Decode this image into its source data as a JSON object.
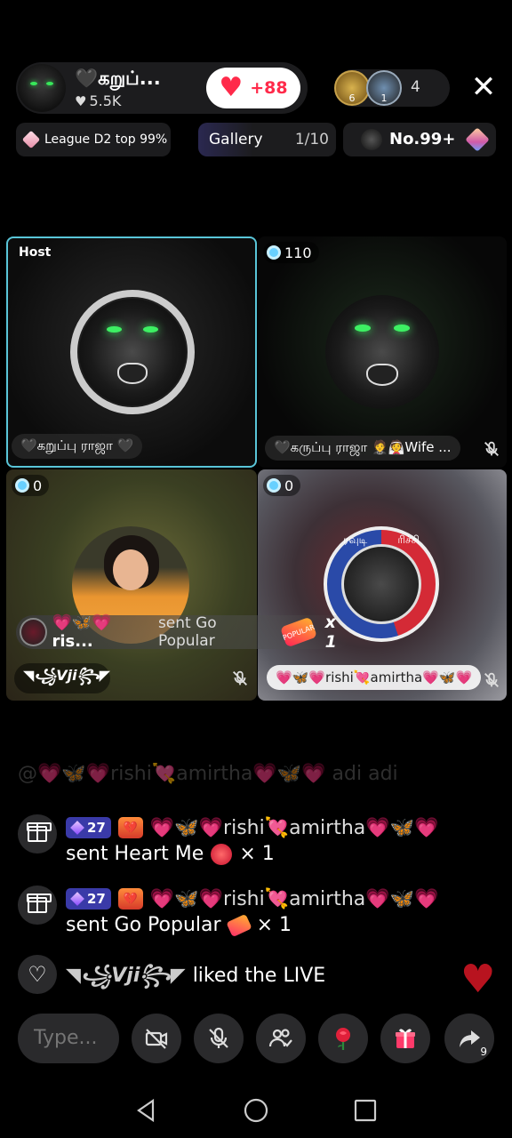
{
  "header": {
    "host_name": "🖤கறுப்...",
    "host_likes": "5.5K",
    "follow_count": "+88",
    "viewer_badge_1": "6",
    "viewer_badge_2": "1",
    "viewer_count": "4"
  },
  "subheader": {
    "league": "League D2 top 99%",
    "gallery_label": "Gallery",
    "gallery_progress": "1/10",
    "rank": "No.99+"
  },
  "tiles": {
    "host_tag": "Host",
    "host_name": "🖤கறுப்பு ராஜா 🖤",
    "guest1_coins": "110",
    "guest1_name": "🖤கருப்பு ராஜா 🤵👰Wife ...",
    "guest2_coins": "0",
    "guest2_name": "◥꧁Vji꧂◤",
    "guest3_coins": "0",
    "guest3_name": "💗🦋💗rishi💘amirtha💗🦋💗",
    "badge_text_left": "ரவுடி",
    "badge_text_right": "ரிச்சி"
  },
  "gift_banner": {
    "sender": "💗🦋💗ris...",
    "action": "sent Go Popular",
    "gift_label": "POPULAR",
    "multiplier": "x 1"
  },
  "chat": {
    "faded_line": "@💗🦋💗rishi💘amirtha💗🦋💗 adi adi",
    "items": [
      {
        "level": "27",
        "fan_badge": "💔",
        "user": "💗🦋💗rishi💘amirtha💗🦋💗",
        "text": "sent Heart Me",
        "count": "× 1"
      },
      {
        "level": "27",
        "fan_badge": "💔",
        "user": "💗🦋💗rishi💘amirtha💗🦋💗",
        "text": "sent Go Popular",
        "count": "× 1"
      }
    ],
    "like_user": "◥꧁Vji꧂◤",
    "like_text": "liked the LIVE"
  },
  "toolbar": {
    "type_placeholder": "Type...",
    "share_count": "9"
  },
  "colors": {
    "accent_red": "#ff2a4a",
    "host_border": "#59c5d8",
    "level_badge": "#3a3aa8"
  },
  "icons": [
    "close-icon",
    "diamond-icon",
    "gem-icon",
    "coin-icon",
    "mic-off-icon",
    "gift-icon",
    "heart-icon",
    "camera-off-icon",
    "mic-off-icon",
    "guests-icon",
    "rose-icon",
    "gift-icon",
    "share-icon",
    "back-icon",
    "home-icon",
    "recents-icon"
  ]
}
